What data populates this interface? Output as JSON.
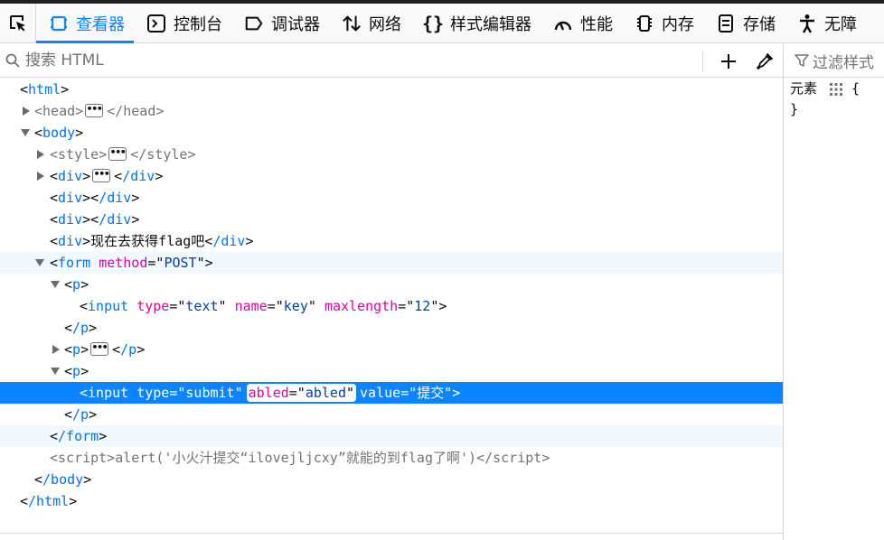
{
  "toolbar": {
    "tabs": [
      {
        "label": "查看器",
        "icon": "inspector-icon"
      },
      {
        "label": "控制台",
        "icon": "console-icon"
      },
      {
        "label": "调试器",
        "icon": "debugger-icon"
      },
      {
        "label": "网络",
        "icon": "network-icon"
      },
      {
        "label": "样式编辑器",
        "icon": "style-editor-icon"
      },
      {
        "label": "性能",
        "icon": "performance-icon"
      },
      {
        "label": "内存",
        "icon": "memory-icon"
      },
      {
        "label": "存储",
        "icon": "storage-icon"
      },
      {
        "label": "无障",
        "icon": "accessibility-icon"
      }
    ],
    "selected_index": 0,
    "accent_color": "#0a84ff"
  },
  "search": {
    "placeholder": "搜索 HTML"
  },
  "rules": {
    "filter_placeholder": "过滤样式",
    "element_selector": "元素",
    "open_brace": "{",
    "close_brace": "}"
  },
  "markup": {
    "html_open": "html",
    "head_open": "head",
    "head_close": "/head",
    "body_open": "body",
    "style_open": "style",
    "style_close": "/style",
    "div": "div",
    "div_close": "/div",
    "div_text": "现在去获得flag吧",
    "form_open": "form",
    "form_attr": "method",
    "form_attr_val": "POST",
    "p": "p",
    "p_close": "/p",
    "input": "input",
    "input1_type_attr": "type",
    "input1_type_val": "text",
    "input1_name_attr": "name",
    "input1_name_val": "key",
    "input1_max_attr": "maxlength",
    "input1_max_val": "12",
    "input2_type_val": "submit",
    "input2_edit_attr": "abled",
    "input2_edit_val": "abled",
    "input2_value_attr": "value",
    "input2_value_val": "提交",
    "form_close": "/form",
    "script_open": "script",
    "script_text": "alert('小火汁提交“ilovejljcxy”就能的到flag了啊')",
    "script_close": "/script",
    "body_close": "/body",
    "html_close": "/html"
  }
}
